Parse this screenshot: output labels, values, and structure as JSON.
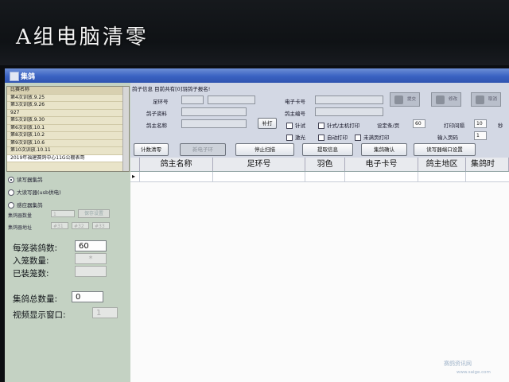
{
  "photo_caption": "A组电脑清零",
  "window": {
    "title": "集鸽"
  },
  "name_list": {
    "header": "比赛名称",
    "items": [
      "第4次训放.9.25",
      "第3次训放.9.26",
      "927",
      "第5次训放.9.30",
      "第6次训放.10.1",
      "第8次训放.10.2",
      "第9次训放.10.6",
      "第10次训放.10.11",
      "2019年福建赛鸽中心11G公棚表哥"
    ],
    "selected_index": 8
  },
  "reader_options": [
    {
      "label": "读写器集鸽",
      "checked": true
    },
    {
      "label": "大读写器(usb供电)",
      "checked": false
    },
    {
      "label": "感应器集鸽",
      "checked": false
    }
  ],
  "collector": {
    "count_label": "集鸽器数量",
    "count_value": "1",
    "save_button": "保存设置",
    "address_label": "集鸽器地址",
    "address_values": [
      "#31",
      "#32",
      "#33"
    ]
  },
  "cage": {
    "per_cage_label": "每笼装鸽数:",
    "per_cage_value": "60",
    "in_cage_label": "入笼数量:",
    "in_cage_value": "*",
    "loaded_label": "已装笼数:",
    "loaded_value": ""
  },
  "totals": {
    "total_label": "集鸽总数量:",
    "total_value": "0",
    "video_label": "视频显示窗口:",
    "video_value": "1"
  },
  "form": {
    "section_title": "鸽子信息   目前共有[0]羽鸽子报名!",
    "ring_label": "足环号",
    "pigeon_info_label": "鸽子资料",
    "owner_label": "鸽主名称",
    "reprint_button": "补打",
    "chip_label": "电子卡号",
    "owner_no_label": "鸽主编号",
    "needle_label": "针试",
    "needle_print_label": "针式/主机打印",
    "per_page_label": "设定条/页",
    "per_page_value": "60",
    "interval_label": "打印间隔",
    "interval_value": "10",
    "interval_unit": "秒",
    "laser_label": "激光",
    "auto_print_label": "自动打印",
    "unfull_print_label": "未满页打印",
    "input_page_label": "输入页码",
    "input_page_value": "1",
    "submit_button": "提交",
    "modify_button": "修改",
    "cancel_button": "取消",
    "clear_button": "计数清零",
    "new_chip_button": "新电子环",
    "stop_scan_button": "停止扫描",
    "fetch_info_button": "提取信息",
    "confirm_button": "集鸽确认",
    "port_button": "读写器端口设置"
  },
  "grid": {
    "columns": [
      "鸽主名称",
      "足环号",
      "羽色",
      "电子卡号",
      "鸽主地区",
      "集鸽时"
    ]
  },
  "watermark": {
    "text": "赛鸽资讯网",
    "url": "www.saige.com"
  },
  "colors": {
    "titlebar": "#3a62c2",
    "left_panel": "#c4d2c3",
    "list_bg": "#e9e4c9"
  }
}
